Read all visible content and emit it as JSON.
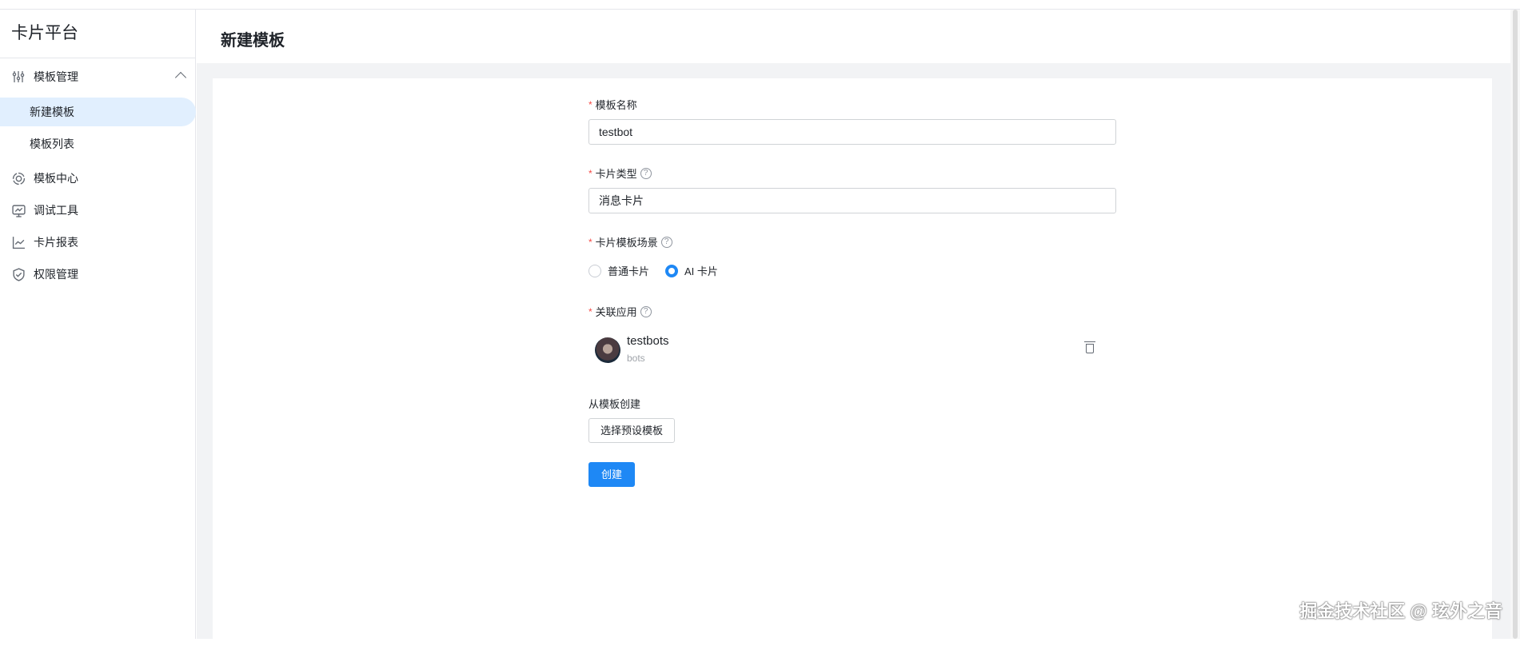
{
  "sidebar": {
    "brand": "卡片平台",
    "items": [
      {
        "label": "模板管理",
        "icon": "sliders-icon",
        "expanded": true,
        "children": [
          {
            "label": "新建模板",
            "active": true
          },
          {
            "label": "模板列表",
            "active": false
          }
        ]
      },
      {
        "label": "模板中心",
        "icon": "target-icon"
      },
      {
        "label": "调试工具",
        "icon": "monitor-icon"
      },
      {
        "label": "卡片报表",
        "icon": "line-chart-icon"
      },
      {
        "label": "权限管理",
        "icon": "shield-icon"
      }
    ]
  },
  "header": {
    "title": "新建模板"
  },
  "form": {
    "name": {
      "label": "模板名称",
      "value": "testbot"
    },
    "type": {
      "label": "卡片类型",
      "value": "消息卡片"
    },
    "scene": {
      "label": "卡片模板场景",
      "options": [
        "普通卡片",
        "AI 卡片"
      ],
      "selected": "AI 卡片"
    },
    "app": {
      "label": "关联应用",
      "name": "testbots",
      "sub": "bots"
    },
    "from_template": {
      "label": "从模板创建",
      "button": "选择预设模板"
    },
    "submit": "创建"
  },
  "watermark": "掘金技术社区 @ 玹外之音",
  "colors": {
    "primary": "#1e88f5",
    "active_bg": "#e1effe",
    "required": "#f54a45"
  }
}
